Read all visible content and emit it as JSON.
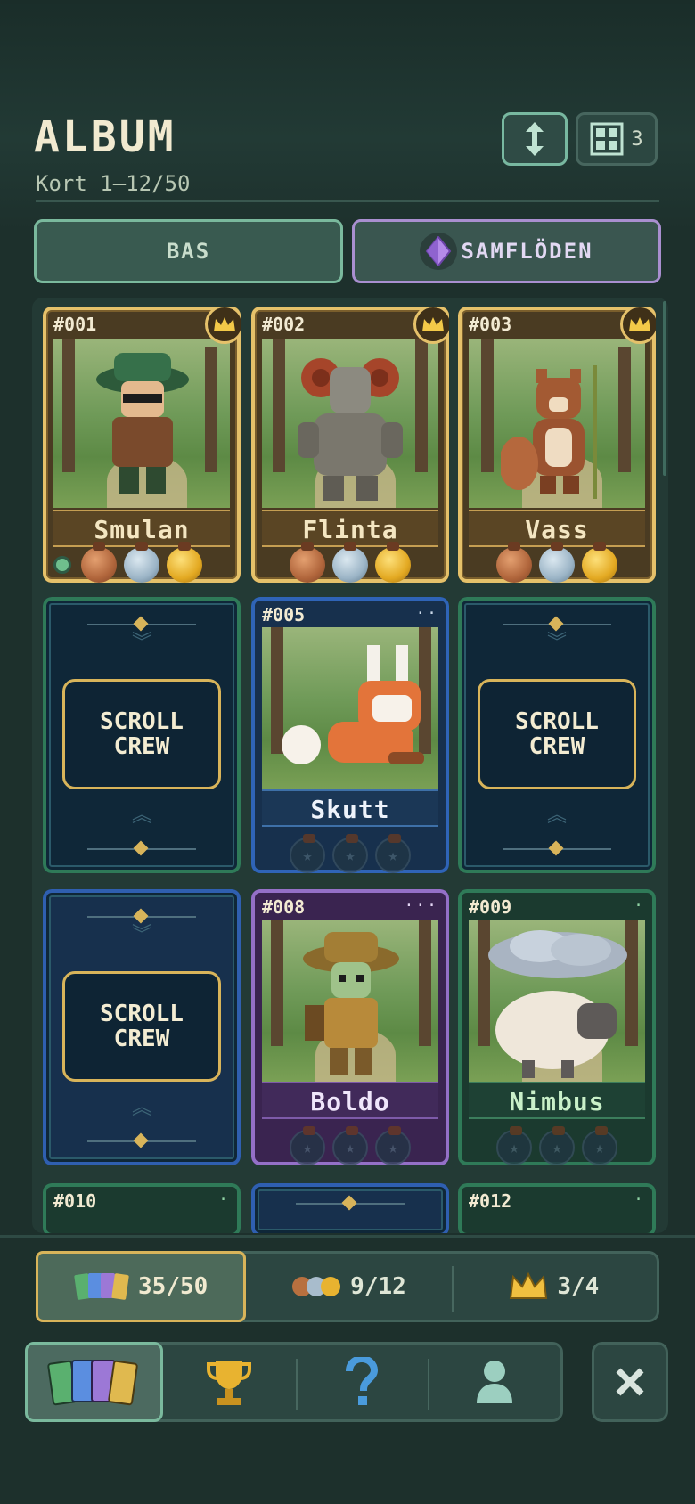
{
  "header": {
    "title": "ALBUM",
    "subtitle": "Kort 1–12/50",
    "sort_icon": "vertical-arrows-icon",
    "grid_icon": "grid-icon",
    "grid_count": "3"
  },
  "tabs": [
    {
      "label": "BAS",
      "active": false
    },
    {
      "label": "SAMFLÖDEN",
      "icon": "purple-gem-icon",
      "active": true
    }
  ],
  "cards": [
    {
      "num": "#001",
      "name": "Smulan",
      "rarity": "gold",
      "crowned": true
    },
    {
      "num": "#002",
      "name": "Flinta",
      "rarity": "gold",
      "crowned": true
    },
    {
      "num": "#003",
      "name": "Vass",
      "rarity": "gold",
      "crowned": true
    },
    {
      "back_text": "SCROLL\nCREW"
    },
    {
      "num": "#005",
      "name": "Skutt",
      "rarity": "blue"
    },
    {
      "back_text": "SCROLL\nCREW"
    },
    {
      "back_text": "SCROLL\nCREW"
    },
    {
      "num": "#008",
      "name": "Boldo",
      "rarity": "purple"
    },
    {
      "num": "#009",
      "name": "Nimbus",
      "rarity": "green"
    },
    {
      "num": "#010"
    },
    {
      "num": "#012"
    }
  ],
  "back_logo_line1": "SCROLL",
  "back_logo_line2": "CREW",
  "stats": {
    "cards": "35/50",
    "medals": "9/12",
    "crowns": "3/4"
  },
  "nav": [
    "cards-icon",
    "trophy-icon",
    "question-icon",
    "profile-icon"
  ],
  "close_icon": "close-icon",
  "colors": {
    "gold": "#e5c16a",
    "blue": "#2f64b7",
    "purple": "#9470c7",
    "green": "#2f7a58",
    "accent": "#7ab99d"
  }
}
